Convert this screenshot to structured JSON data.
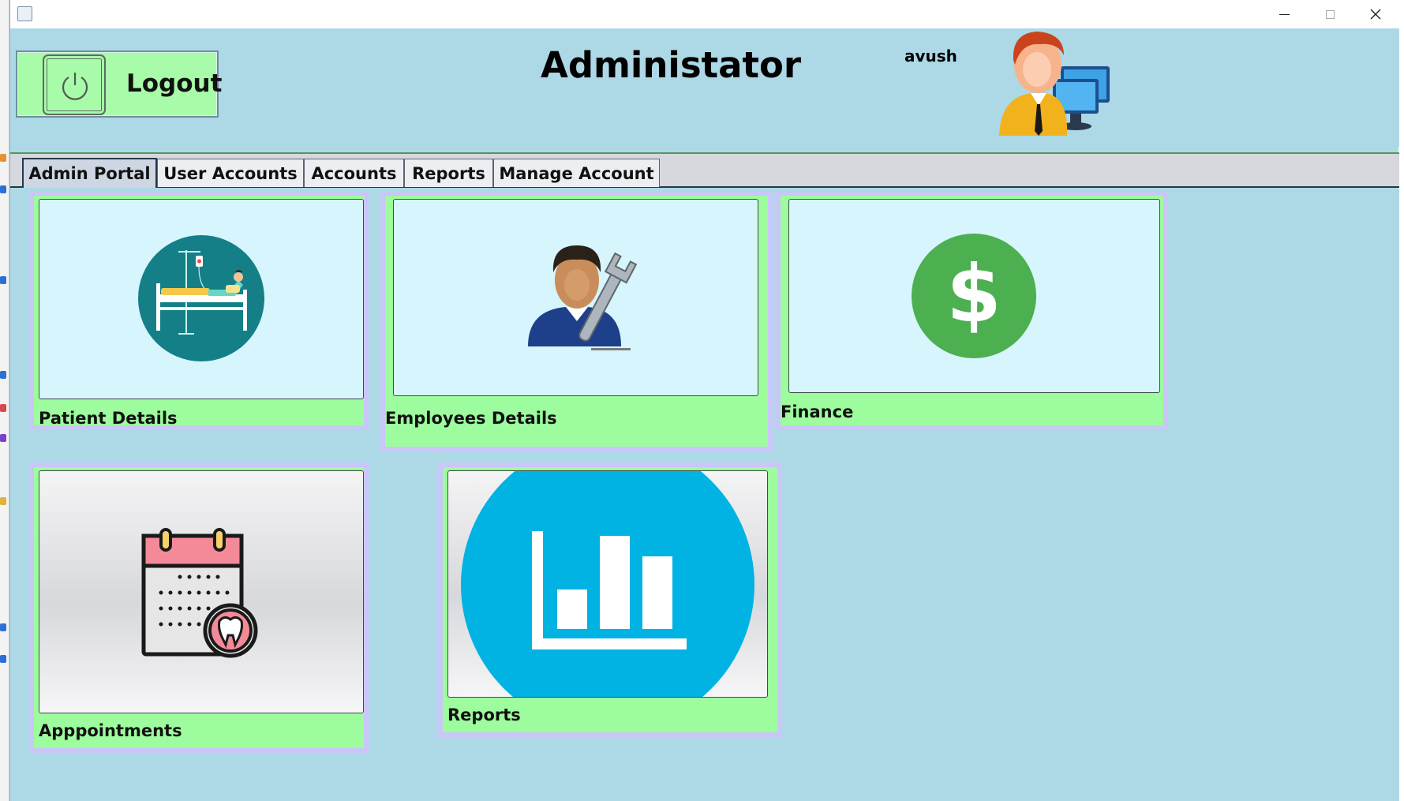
{
  "window": {
    "controls": {
      "minimize": "—",
      "maximize": "☐",
      "close": "✕"
    }
  },
  "header": {
    "logout_label": "Logout",
    "title": "Administator",
    "username": "avush"
  },
  "tabs": [
    {
      "label": "Admin Portal",
      "active": true
    },
    {
      "label": "User Accounts",
      "active": false
    },
    {
      "label": "Accounts",
      "active": false
    },
    {
      "label": "Reports",
      "active": false
    },
    {
      "label": "Manage Account",
      "active": false
    }
  ],
  "cards": {
    "patient": {
      "label": "Patient Details",
      "icon": "patient-bed-icon"
    },
    "employees": {
      "label": "Employees Details",
      "icon": "employee-wrench-icon"
    },
    "finance": {
      "label": "Finance",
      "icon": "dollar-icon"
    },
    "appointments": {
      "label": "Apppointments",
      "icon": "dental-calendar-icon"
    },
    "reports": {
      "label": "Reports",
      "icon": "bar-chart-icon"
    }
  },
  "colors": {
    "window_bg": "#add8e6",
    "card_bg": "#9dfc9d",
    "card_border": "#c9c6f8",
    "logout_bg": "#a8fba8",
    "finance_green": "#4caf50",
    "reports_blue": "#00b3e3",
    "patient_teal": "#147f87"
  }
}
